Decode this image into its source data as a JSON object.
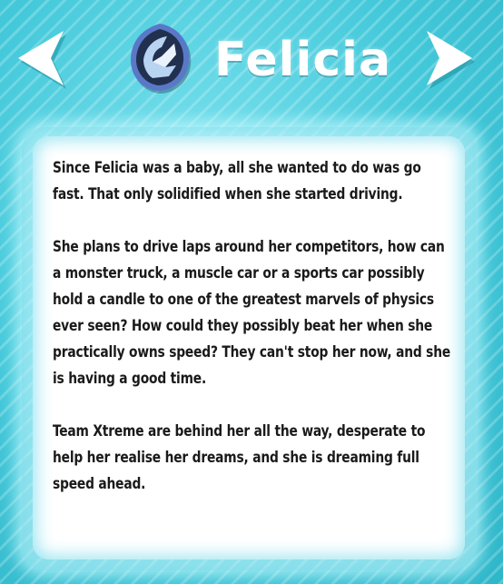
{
  "header": {
    "title": "Felicia",
    "prev_icon": "chevron-left-icon",
    "next_icon": "chevron-right-icon",
    "emblem_icon": "team-xtreme-emblem-icon"
  },
  "description": {
    "paragraphs": [
      "Since Felicia was a baby, all she wanted to do was go fast. That only solidified when she started driving.",
      "She plans to drive laps around her competitors, how can a monster truck, a muscle car or a sports car possibly hold a candle to one of the greatest marvels of physics ever seen? How could they possibly beat her when she practically owns speed? They can't stop her now, and she is having a good time.",
      "Team Xtreme are behind her all the way, desperate to help her realise her dreams, and she is dreaming full speed ahead."
    ]
  },
  "colors": {
    "background": "#44c9da",
    "panel": "#ffffff",
    "text": "#1a1a1a",
    "title": "#ffffff"
  }
}
